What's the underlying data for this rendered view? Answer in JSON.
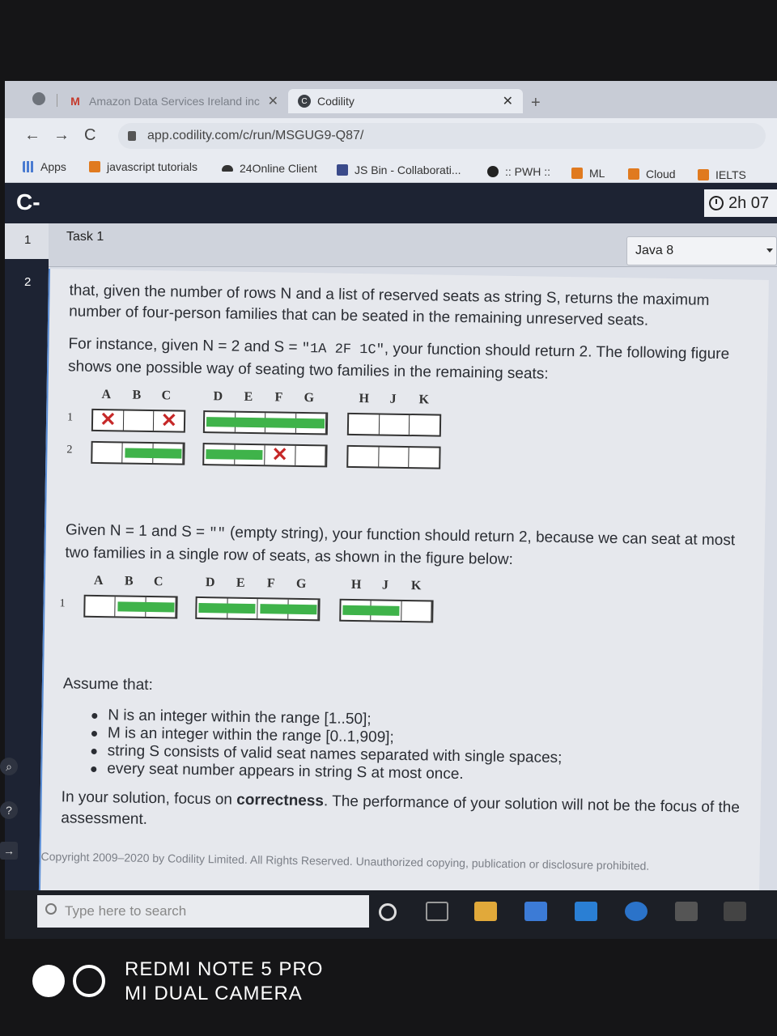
{
  "browser": {
    "tabs": [
      {
        "title": "Amazon Data Services Ireland inc",
        "icon": "gmail-icon"
      },
      {
        "title": "Codility",
        "icon": "codility-icon"
      }
    ],
    "url": "app.codility.com/c/run/MSGUG9-Q87/",
    "bookmarks": [
      "Apps",
      "javascript tutorials",
      "24Online Client",
      "JS Bin - Collaborati...",
      ":: PWH ::",
      "ML",
      "Cloud",
      "IELTS"
    ]
  },
  "app": {
    "logo": "C-",
    "timer": "2h 07",
    "rail": [
      "1",
      "2"
    ],
    "task_title": "Task 1",
    "language": "Java 8"
  },
  "content": {
    "para1": "that, given the number of rows N and a list of reserved seats as string S, returns the maximum number of four-person families that can be seated in the remaining unreserved seats.",
    "para2_a": "For instance, given N = 2 and S = ",
    "para2_code": "\"1A 2F 1C\"",
    "para2_b": ", your function should return 2. The following figure shows one possible way of seating two families in the remaining seats:",
    "para3_a": "Given N = 1 and S = ",
    "para3_code": "\"\"",
    "para3_b": " (empty string), your function should return 2, because we can seat at most two families in a single row of seats, as shown in the figure below:",
    "seat_letters": [
      "A",
      "B",
      "C",
      "D",
      "E",
      "F",
      "G",
      "H",
      "J",
      "K"
    ],
    "fig1_rows": [
      "1",
      "2"
    ],
    "fig2_rows": [
      "1"
    ],
    "assume": "Assume that:",
    "bullets": [
      "N is an integer within the range [1..50];",
      "M is an integer within the range [0..1,909];",
      "string S consists of valid seat names separated with single spaces;",
      "every seat number appears in string S at most once."
    ],
    "focus_a": "In your solution, focus on ",
    "focus_bold": "correctness",
    "focus_b": ". The performance of your solution will not be the focus of the assessment.",
    "copyright": "Copyright 2009–2020 by Codility Limited. All Rights Reserved. Unauthorized copying, publication or disclosure prohibited."
  },
  "taskbar": {
    "search_placeholder": "Type here to search"
  },
  "camera": {
    "line1": "REDMI NOTE 5 PRO",
    "line2": "MI DUAL CAMERA"
  }
}
